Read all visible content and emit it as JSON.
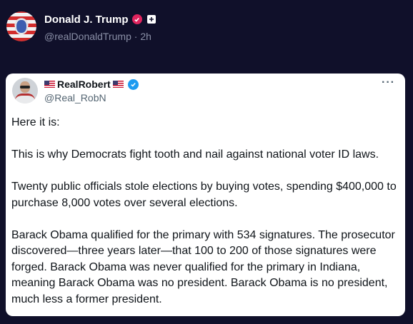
{
  "post": {
    "author_name": "Donald J. Trump",
    "author_handle": "@realDonaldTrump",
    "separator": "·",
    "time": "2h"
  },
  "quoted": {
    "author_name": "RealRobert",
    "author_handle": "@Real_RobN",
    "more_label": "···",
    "paragraphs": [
      "Here it is:",
      "This is why Democrats fight tooth and nail against national voter ID laws.",
      "Twenty public officials stole elections by buying votes, spending $400,000 to purchase 8,000 votes over several elections.",
      "Barack Obama qualified for the primary with 534 signatures. The prosecutor discovered—three years later—that 100 to 200 of those signatures were forged. Barack Obama was never qualified for the primary in Indiana, meaning Barack Obama was no president. Barack Obama is no president, much less a former president."
    ]
  },
  "colors": {
    "background": "#10102a",
    "card": "#ffffff",
    "verified_pink": "#e0245e",
    "verified_blue": "#1d9bf0"
  },
  "icons": [
    "avatar",
    "verified-badge-icon",
    "plus-badge-icon",
    "us-flag-icon",
    "more-icon"
  ]
}
